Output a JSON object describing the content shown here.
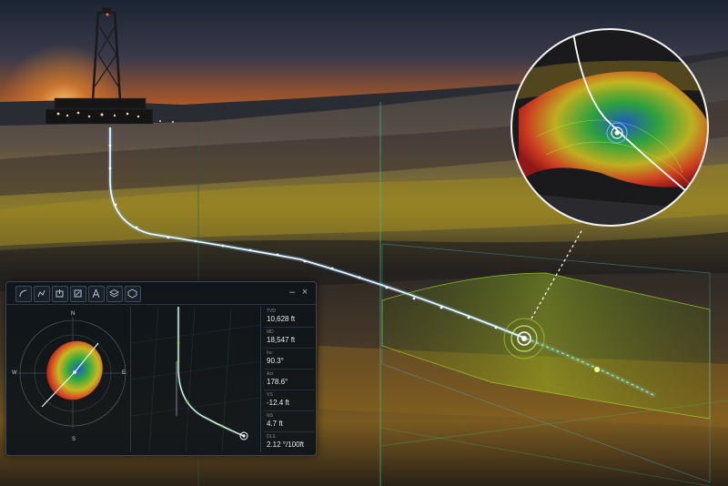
{
  "toolbar": {
    "tools": [
      {
        "name": "trajectory-tool",
        "icon": "curve-icon"
      },
      {
        "name": "path-tool",
        "icon": "path-icon"
      },
      {
        "name": "export-tool",
        "icon": "export-icon"
      },
      {
        "name": "edit-tool",
        "icon": "edit-icon"
      },
      {
        "name": "rig-tool",
        "icon": "rig-icon"
      },
      {
        "name": "layers-tool",
        "icon": "layers-icon"
      },
      {
        "name": "stack-tool",
        "icon": "stack-icon"
      }
    ],
    "minimize_label": "–",
    "close_label": "×"
  },
  "compass": {
    "north": "N",
    "south": "S",
    "east": "E",
    "west": "W"
  },
  "readouts": [
    {
      "label": "TVD",
      "value": "10,628 ft"
    },
    {
      "label": "MD",
      "value": "18,547 ft"
    },
    {
      "label": "Inc",
      "value": "90.3°"
    },
    {
      "label": "Azi",
      "value": "178.6°"
    },
    {
      "label": "VS",
      "value": "-12.4 ft"
    },
    {
      "label": "NS",
      "value": "4.7 ft"
    },
    {
      "label": "DLS",
      "value": "2.12 °/100ft"
    }
  ],
  "colors": {
    "trajectory": "#9fd8ff",
    "target_zone": "#9fd22a",
    "sky_glow": "#f08a2a",
    "panel_bg": "#0e141a"
  }
}
